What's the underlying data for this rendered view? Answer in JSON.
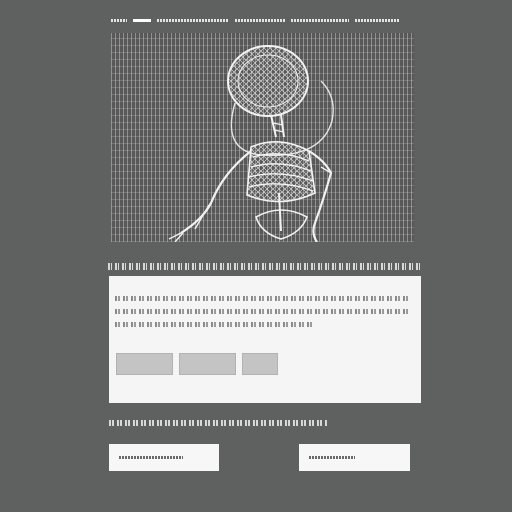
{
  "header": {
    "title": ""
  },
  "hero": {
    "icon": "skeleton-illustration-icon"
  },
  "caption": {
    "text": ""
  },
  "card": {
    "line1": "",
    "line2": "",
    "buttons": [
      {
        "label": ""
      },
      {
        "label": ""
      },
      {
        "label": ""
      }
    ]
  },
  "footer": {
    "caption": "",
    "box_left": {
      "value": ""
    },
    "box_right": {
      "value": ""
    }
  },
  "colors": {
    "background": "#5f6060",
    "card": "#f5f5f5",
    "button": "#c4c4c4"
  }
}
